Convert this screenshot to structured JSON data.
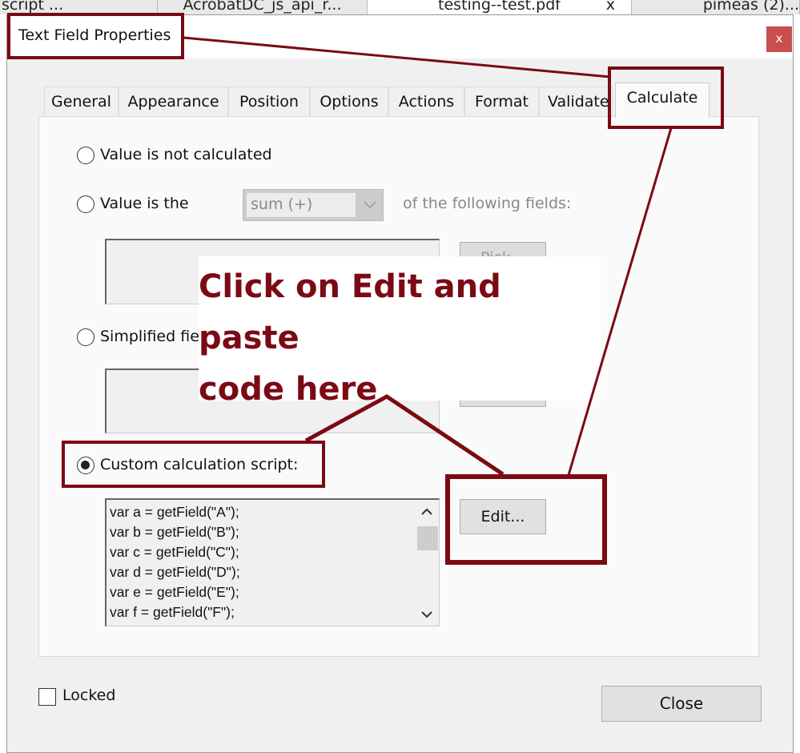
{
  "background_tabs": [
    {
      "label": "script ..."
    },
    {
      "label": "AcrobatDC_js_api_r..."
    },
    {
      "label": "testing--test.pdf",
      "close": "x"
    },
    {
      "label": "pimeas (2)..."
    }
  ],
  "dialog": {
    "title": "Text Field Properties",
    "close_icon": "x",
    "tabs": [
      {
        "label": "General"
      },
      {
        "label": "Appearance"
      },
      {
        "label": "Position"
      },
      {
        "label": "Options"
      },
      {
        "label": "Actions"
      },
      {
        "label": "Format"
      },
      {
        "label": "Validate"
      },
      {
        "label": "Calculate",
        "selected": true
      }
    ],
    "options": {
      "not_calculated": "Value is not calculated",
      "value_is_the": "Value is the",
      "operation_select": "sum (+)",
      "of_following": "of the following fields:",
      "pick_label": "Pick...",
      "simplified": "Simplified fie",
      "custom": "Custom calculation script:",
      "selected": "custom"
    },
    "script_lines": [
      "var a = getField(\"A\");",
      "var b = getField(\"B\");",
      "var c = getField(\"C\");",
      "var d = getField(\"D\");",
      "var e = getField(\"E\");",
      "var f = getField(\"F\");"
    ],
    "edit_button": "Edit...",
    "locked_label": "Locked",
    "locked": false,
    "close_button": "Close"
  },
  "annotation": {
    "line1": "Click on Edit and paste",
    "line2": "code here",
    "color": "#7b0a14"
  }
}
